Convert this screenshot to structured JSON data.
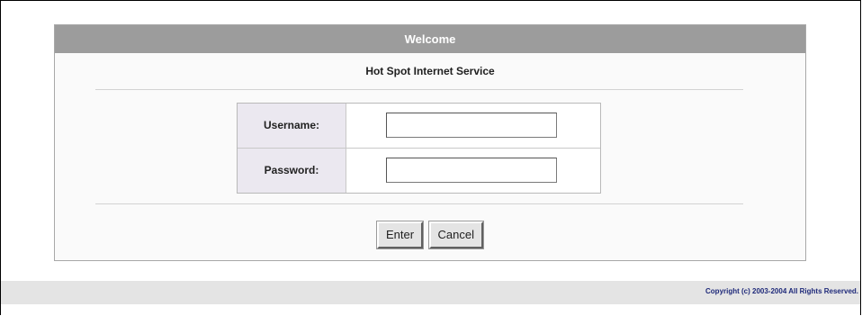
{
  "header": {
    "title": "Welcome"
  },
  "main": {
    "service_title": "Hot Spot Internet Service",
    "username_label": "Username:",
    "username_value": "",
    "password_label": "Password:",
    "password_value": "",
    "enter_label": "Enter",
    "cancel_label": "Cancel"
  },
  "footer": {
    "copyright": "Copyright (c) 2003-2004 All Rights Reserved."
  },
  "colors": {
    "header_bar": "#9c9c9c",
    "label_bg": "#ebe8f0",
    "footer_bar": "#e4e4e4",
    "copyright_text": "#1f2a7a"
  }
}
